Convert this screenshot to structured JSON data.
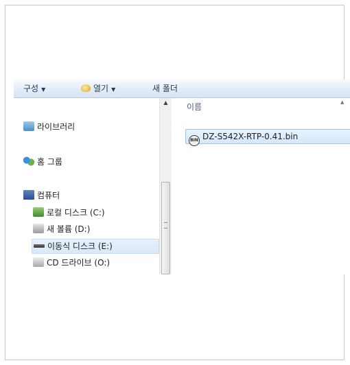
{
  "toolbar": {
    "organize_label": "구성",
    "open_label": "열기",
    "new_folder_label": "새 폴더",
    "dropdown_glyph": "▼"
  },
  "nav": {
    "items": [
      {
        "label": "라이브러리",
        "icon": "library-icon"
      },
      {
        "label": "홈 그룹",
        "icon": "homegroup-icon"
      },
      {
        "label": "컴퓨터",
        "icon": "computer-icon"
      },
      {
        "label": "로컬 디스크 (C:)",
        "icon": "local-disk-icon"
      },
      {
        "label": "새 볼륨 (D:)",
        "icon": "volume-icon"
      },
      {
        "label": "이동식 디스크 (E:)",
        "icon": "removable-disk-icon",
        "selected": true
      },
      {
        "label": "CD 드라이브 (O:)",
        "icon": "cd-drive-icon"
      }
    ]
  },
  "content": {
    "column_name": "이름",
    "files": [
      {
        "name": "DZ-S542X-RTP-0.41.bin",
        "icon": "bin-file-icon",
        "icon_text": "BIN",
        "selected": true
      }
    ]
  },
  "colors": {
    "toolbar_text": "#1e395b",
    "selection": "#d5e7fa"
  }
}
